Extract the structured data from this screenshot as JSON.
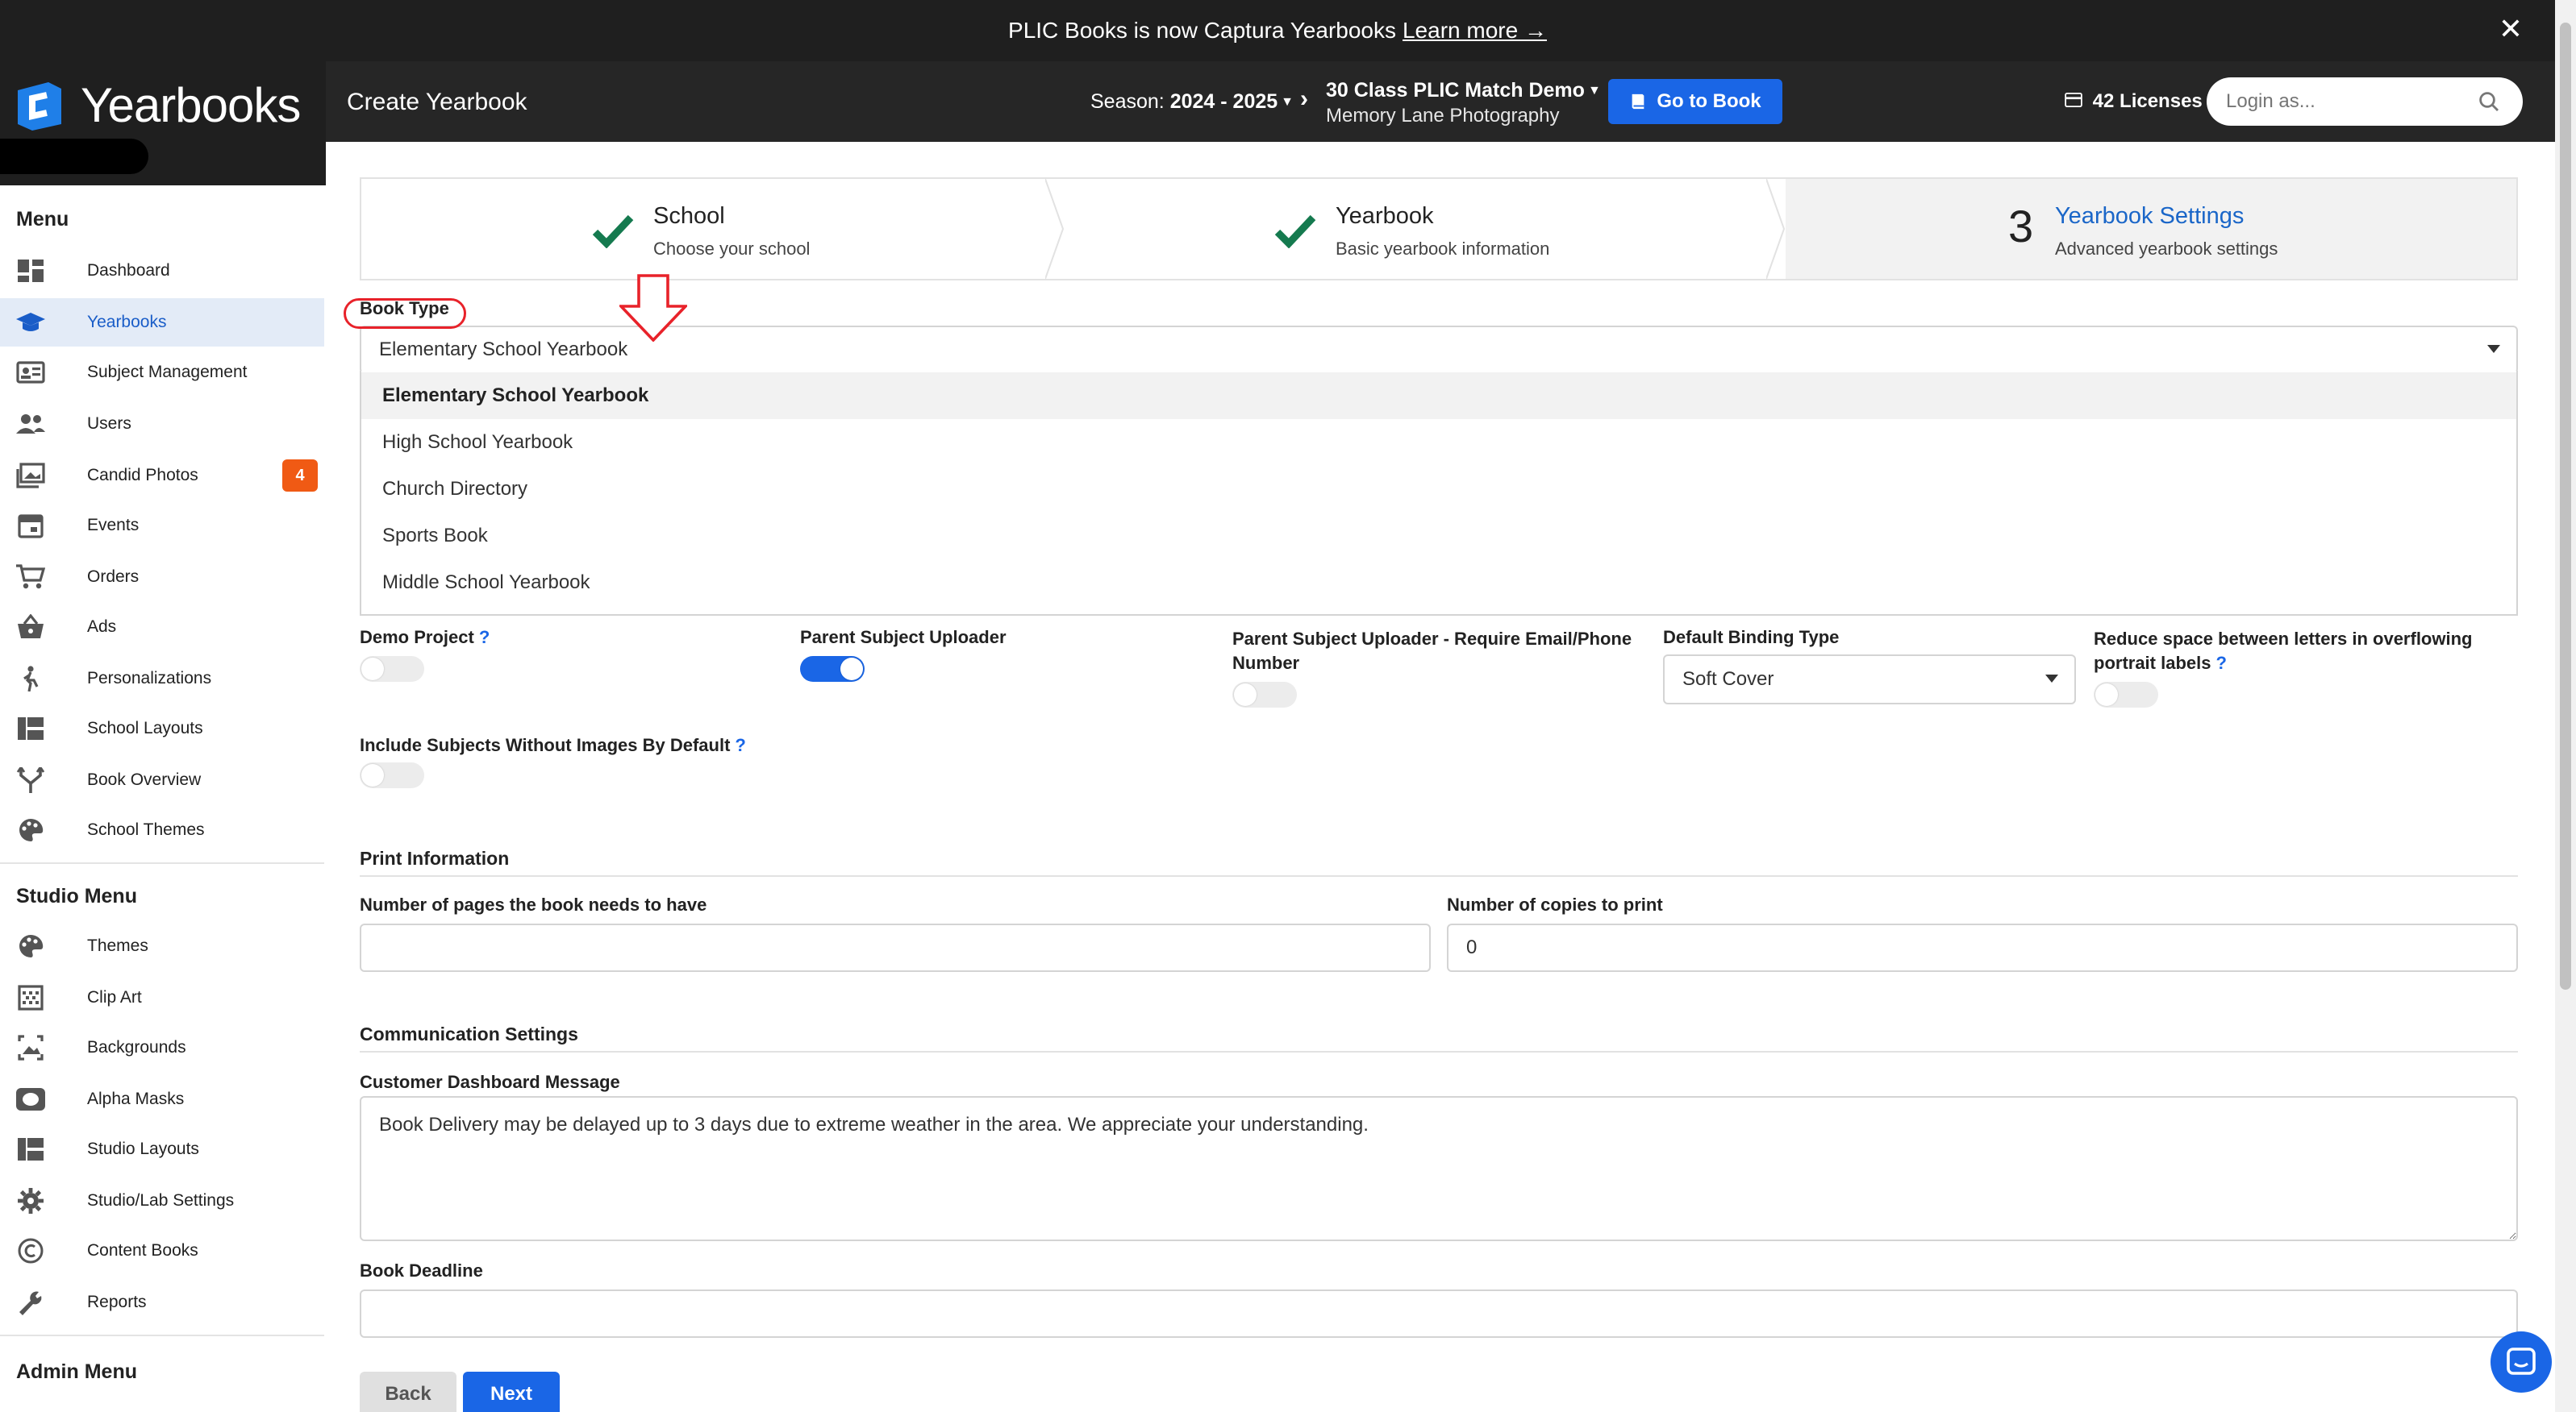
{
  "banner": {
    "text": "PLIC Books is now Captura Yearbooks",
    "link": "Learn more →",
    "close": "✕"
  },
  "brand": {
    "name": "Yearbooks"
  },
  "header": {
    "page_title": "Create Yearbook",
    "season_label": "Season:",
    "season_value": "2024 - 2025",
    "book_name": "30 Class PLIC Match Demo",
    "studio_name": "Memory Lane Photography",
    "goto_button": "Go to Book",
    "licenses": "42 Licenses",
    "login_placeholder": "Login as..."
  },
  "sidebar": {
    "menu_heading": "Menu",
    "items": [
      {
        "label": "Dashboard"
      },
      {
        "label": "Yearbooks"
      },
      {
        "label": "Subject Management"
      },
      {
        "label": "Users"
      },
      {
        "label": "Candid Photos",
        "badge": "4"
      },
      {
        "label": "Events"
      },
      {
        "label": "Orders"
      },
      {
        "label": "Ads"
      },
      {
        "label": "Personalizations"
      },
      {
        "label": "School Layouts"
      },
      {
        "label": "Book Overview"
      },
      {
        "label": "School Themes"
      }
    ],
    "studio_heading": "Studio Menu",
    "studio_items": [
      {
        "label": "Themes"
      },
      {
        "label": "Clip Art"
      },
      {
        "label": "Backgrounds"
      },
      {
        "label": "Alpha Masks"
      },
      {
        "label": "Studio Layouts"
      },
      {
        "label": "Studio/Lab Settings"
      },
      {
        "label": "Content Books"
      },
      {
        "label": "Reports"
      }
    ],
    "admin_heading": "Admin Menu"
  },
  "steps": [
    {
      "title": "School",
      "subtitle": "Choose your school"
    },
    {
      "title": "Yearbook",
      "subtitle": "Basic yearbook information"
    },
    {
      "number": "3",
      "title": "Yearbook Settings",
      "subtitle": "Advanced yearbook settings"
    }
  ],
  "form": {
    "book_type_label": "Book Type",
    "book_type_value": "Elementary School Yearbook",
    "book_type_options": [
      "Elementary School Yearbook",
      "High School Yearbook",
      "Church Directory",
      "Sports Book",
      "Middle School Yearbook"
    ],
    "demo_project_label": "Demo Project",
    "parent_uploader_label": "Parent Subject Uploader",
    "parent_uploader_on": true,
    "parent_uploader_email_label": "Parent Subject Uploader - Require Email/Phone Number",
    "binding_label": "Default Binding Type",
    "binding_value": "Soft Cover",
    "reduce_space_label": "Reduce space between letters in overflowing portrait labels",
    "include_subjects_label": "Include Subjects Without Images By Default",
    "help_mark": "?",
    "print_heading": "Print Information",
    "pages_label": "Number of pages the book needs to have",
    "pages_value": "",
    "copies_label": "Number of copies to print",
    "copies_value": "0",
    "comm_heading": "Communication Settings",
    "dashboard_msg_label": "Customer Dashboard Message",
    "dashboard_msg_value": "Book Delivery may be delayed up to 3 days due to extreme weather in the area. We appreciate your understanding.",
    "deadline_label": "Book Deadline",
    "deadline_value": "",
    "back_button": "Back",
    "next_button": "Next"
  },
  "colors": {
    "accent": "#1a66e6",
    "check": "#157a4f",
    "badge": "#f05a14",
    "annotation": "#e8222a"
  }
}
